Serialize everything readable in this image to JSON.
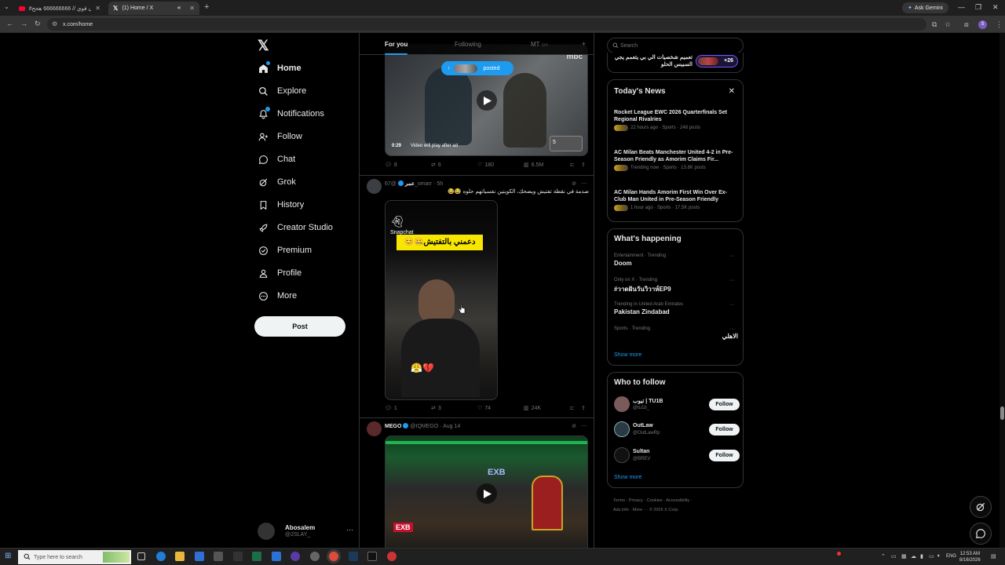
{
  "browser": {
    "tabs": [
      {
        "title": "#تيبون قوي // 666666666 هحح..."
      },
      {
        "title": "(1) Home / X"
      }
    ],
    "url": "x.com/home",
    "gemini_label": "Ask Gemini",
    "profile_initial": "S"
  },
  "nav": {
    "items": [
      {
        "label": "Home",
        "icon": "home-icon"
      },
      {
        "label": "Explore",
        "icon": "search-icon"
      },
      {
        "label": "Notifications",
        "icon": "bell-icon"
      },
      {
        "label": "Follow",
        "icon": "person-add-icon"
      },
      {
        "label": "Chat",
        "icon": "chat-icon"
      },
      {
        "label": "Grok",
        "icon": "grok-icon"
      },
      {
        "label": "History",
        "icon": "bookmark-icon"
      },
      {
        "label": "Creator Studio",
        "icon": "rocket-icon"
      },
      {
        "label": "Premium",
        "icon": "verified-icon"
      },
      {
        "label": "Profile",
        "icon": "person-icon"
      },
      {
        "label": "More",
        "icon": "more-circle-icon"
      }
    ],
    "post_label": "Post",
    "account": {
      "name": "Abosalem",
      "handle": "@2SLAY_"
    }
  },
  "feed": {
    "tabs": [
      {
        "label": "For you",
        "active": true
      },
      {
        "label": "Following",
        "active": false
      },
      {
        "label": "MT",
        "sub": "1m",
        "active": false
      }
    ],
    "posted_pill": "posted",
    "tweets": [
      {
        "media": {
          "duration": "0:29",
          "note": "Video will play after ad",
          "badge": "mbc",
          "count_badge": "5"
        },
        "actions": {
          "replies": "8",
          "reposts": "6",
          "likes": "180",
          "views": "6.5M"
        }
      },
      {
        "author": "عمر",
        "handle": "@67_omarr",
        "time": "5h",
        "text": "صدمة في نقطة تفتيش ويضحك، الكويتين نفسياتهم حلوه 😂😂",
        "media": {
          "app_label": "Snapchat",
          "caption": "دعمني بالتفتيش🤐😊",
          "emojis": "😤💔"
        },
        "actions": {
          "replies": "1",
          "reposts": "3",
          "likes": "74",
          "views": "24K"
        }
      },
      {
        "author": "MEGO",
        "handle": "@IQMEGO",
        "time": "Aug 14",
        "media": {
          "label": "EXB"
        }
      }
    ]
  },
  "right": {
    "search_placeholder": "Search",
    "promo": {
      "text": "تعميم شخصيات الي بي يتعمم يجي السبيس الحلو",
      "count": "+26"
    },
    "todays_news": {
      "title": "Today's News",
      "items": [
        {
          "title": "Rocket League EWC 2026 Quarterfinals Set Regional Rivalries",
          "meta": "22 hours ago · Sports · 248 posts"
        },
        {
          "title": "AC Milan Beats Manchester United 4-2 in Pre-Season Friendly as Amorim Claims Fir...",
          "meta": "Trending now · Sports · 13.8K posts"
        },
        {
          "title": "AC Milan Hands Amorim First Win Over Ex-Club Man United in Pre-Season Friendly",
          "meta": "1 hour ago · Sports · 17.5K posts"
        }
      ]
    },
    "happening": {
      "title": "What's happening",
      "items": [
        {
          "context": "Entertainment · Trending",
          "name": "Doom"
        },
        {
          "context": "Only on X · Trending",
          "name": "#วาดฝันวันวิวาห์EP9"
        },
        {
          "context": "Trending in United Arab Emirates",
          "name": "Pakistan Zindabad"
        },
        {
          "context": "Sports · Trending",
          "name": "الاهلي"
        }
      ],
      "show_more": "Show more"
    },
    "who_to_follow": {
      "title": "Who to follow",
      "items": [
        {
          "name": "تيوب | TU1B",
          "handle": "@tu1b_",
          "button": "Follow"
        },
        {
          "name": "OutLaw",
          "handle": "@OutLawRp",
          "button": "Follow"
        },
        {
          "name": "Sultan",
          "handle": "@BREV",
          "button": "Follow"
        }
      ],
      "show_more": "Show more"
    },
    "footer": {
      "line1": "Terms · Privacy · Cookies · Accessibility ·",
      "line2": "Ads info · More ··· © 2026 X Corp."
    }
  },
  "taskbar": {
    "search_placeholder": "Type here to search",
    "lang": "ENG",
    "time": "12:53 AM",
    "date": "8/16/2026"
  }
}
